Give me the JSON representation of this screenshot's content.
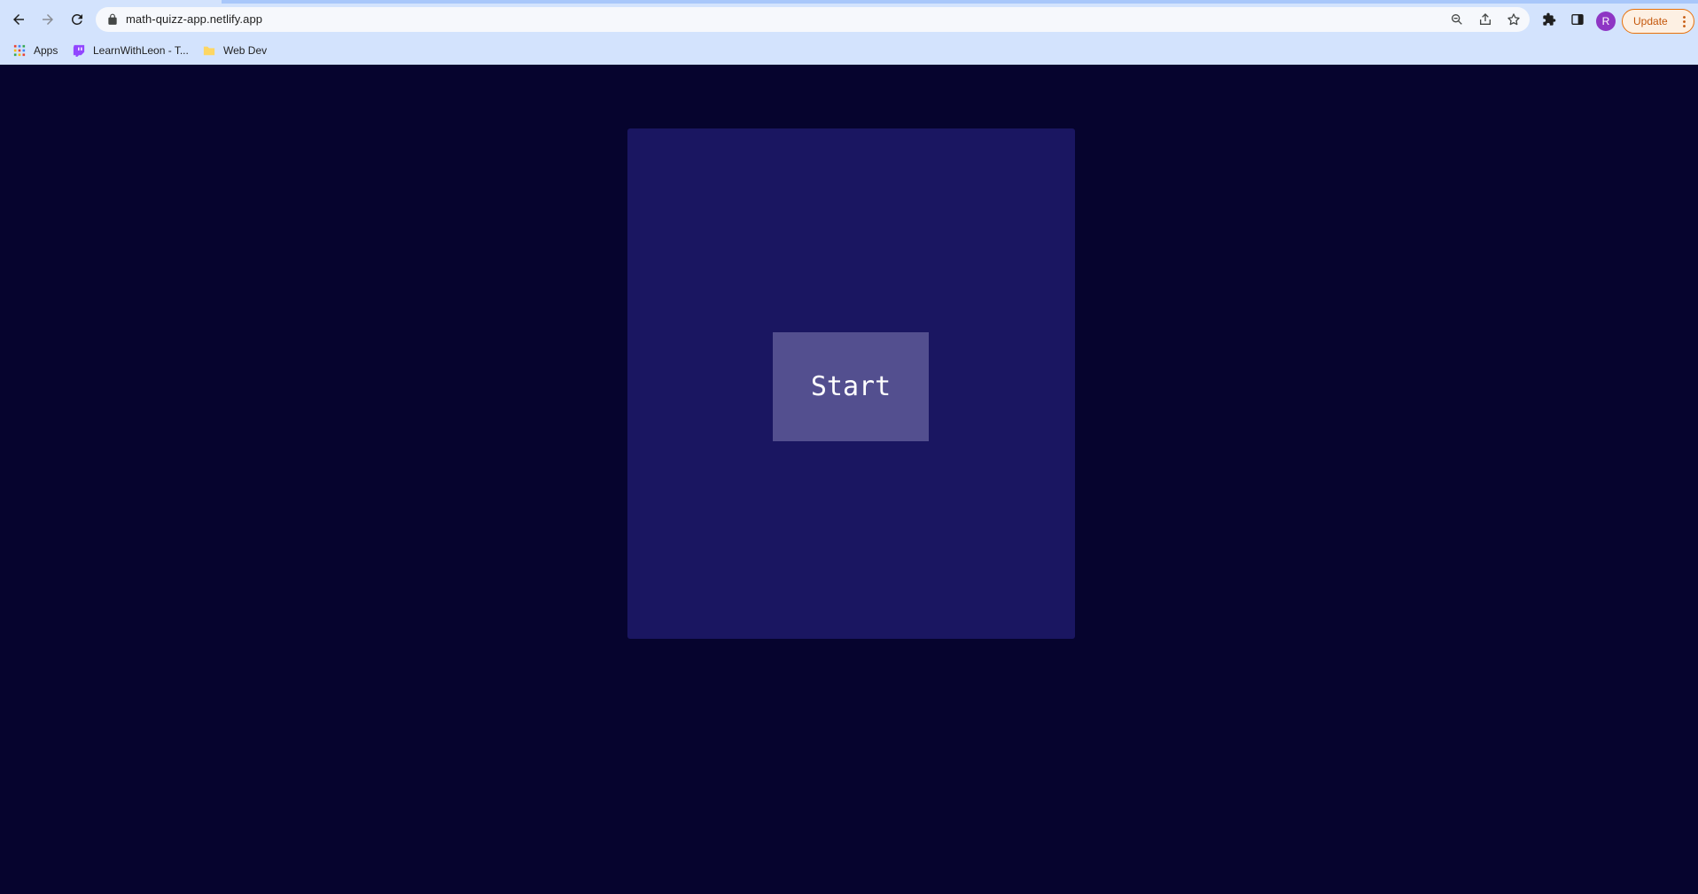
{
  "browser": {
    "url": "math-quizz-app.netlify.app",
    "profile_initial": "R",
    "update_label": "Update",
    "bookmarks": [
      {
        "label": "Apps",
        "icon": "apps-grid-icon"
      },
      {
        "label": "LearnWithLeon - T...",
        "icon": "twitch-icon"
      },
      {
        "label": "Web Dev",
        "icon": "folder-icon"
      }
    ]
  },
  "quiz": {
    "start_label": "Start"
  },
  "colors": {
    "page_bg": "#06042e",
    "card_bg": "#1a1661",
    "button_bg": "#534f8f",
    "chrome_bg": "#d3e3fd",
    "update_accent": "#e8710a"
  }
}
